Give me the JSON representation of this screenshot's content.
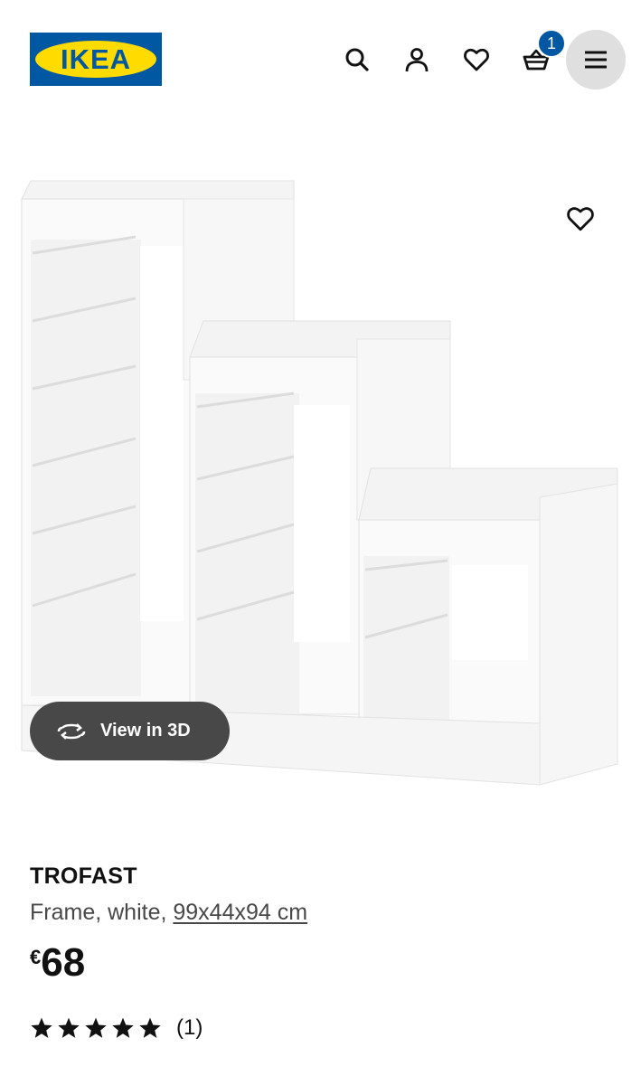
{
  "header": {
    "logo_text": "IKEA",
    "cart_count": "1",
    "icons": [
      "search-icon",
      "user-icon",
      "heart-icon",
      "basket-icon",
      "menu-icon"
    ]
  },
  "media": {
    "view3d_label": "View in 3D",
    "icon": "rotate-3d-icon"
  },
  "product": {
    "name": "TROFAST",
    "description": "Frame, white, ",
    "measurement": "99x44x94 cm",
    "currency": "€",
    "price": "68",
    "rating": 5,
    "rating_max": 5,
    "review_count": "(1)"
  },
  "colors": {
    "brand_blue": "#0058a3",
    "brand_yellow": "#ffdb00",
    "pill_dark": "#484848",
    "menu_bg": "#dfdfdf"
  }
}
